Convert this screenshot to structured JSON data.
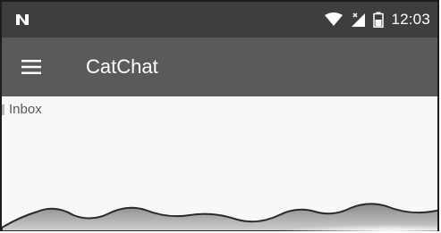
{
  "status_bar": {
    "time": "12:03",
    "icons": [
      "notification-n-icon",
      "wifi-icon",
      "signal-no-data-icon",
      "battery-icon"
    ]
  },
  "app_bar": {
    "title": "CatChat",
    "menu_icon": "hamburger-menu-icon"
  },
  "content": {
    "section_label": "Inbox"
  },
  "colors": {
    "status_bar": "#3e3e3e",
    "app_bar": "#5a5a5a",
    "background": "#f8f8f8"
  }
}
